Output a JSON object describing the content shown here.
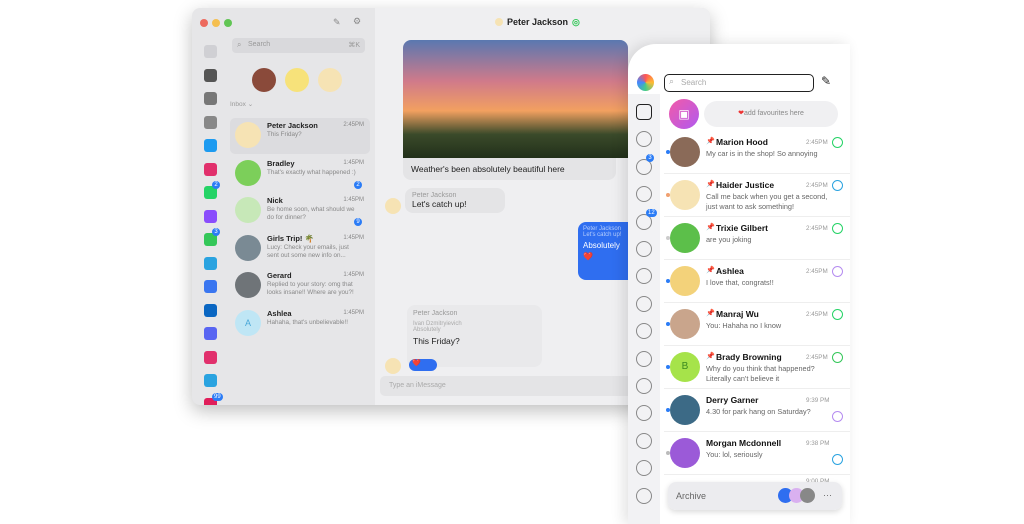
{
  "desktop": {
    "chat_title": "Peter Jackson",
    "search_placeholder": "Search",
    "search_shortcut": "⌘K",
    "inbox_label": "Inbox ⌄",
    "rail": [
      {
        "icon": "layers-icon",
        "color": "#d0d0d4"
      },
      {
        "icon": "chat-bubbles-icon",
        "color": "#555"
      },
      {
        "icon": "inbox-icon",
        "color": "#777"
      },
      {
        "icon": "arrow-icon",
        "color": "#888"
      },
      {
        "icon": "twitter-icon",
        "color": "#1d9bf0"
      },
      {
        "icon": "instagram-icon",
        "color": "#e1306c"
      },
      {
        "icon": "whatsapp-icon",
        "color": "#25d366",
        "badge": "2"
      },
      {
        "icon": "messenger-icon",
        "color": "#8a4dfc"
      },
      {
        "icon": "imessage-icon",
        "color": "#34c759",
        "badge": "3"
      },
      {
        "icon": "telegram-icon",
        "color": "#2aa3e0"
      },
      {
        "icon": "signal-icon",
        "color": "#3a76f0"
      },
      {
        "icon": "linkedin-icon",
        "color": "#0a66c2"
      },
      {
        "icon": "discord-icon",
        "color": "#5865f2"
      },
      {
        "icon": "instagram-icon",
        "color": "#e1306c"
      },
      {
        "icon": "telegram-icon",
        "color": "#2aa3e0"
      },
      {
        "icon": "slack-icon",
        "color": "#e01e5a",
        "badge": "99"
      }
    ],
    "conversations": [
      {
        "name": "Peter Jackson",
        "time": "2:45PM",
        "preview": "This Friday?",
        "avatar": "#f6e3b4",
        "pinned": true
      },
      {
        "name": "Bradley",
        "time": "1:45PM",
        "preview": "That's exactly what happened :)",
        "avatar": "#7ccf5a",
        "badge": "2"
      },
      {
        "name": "Nick",
        "time": "1:45PM",
        "preview": "Be home soon, what should we do for dinner?",
        "avatar": "#c7e8b8",
        "badge": "9"
      },
      {
        "name": "Girls Trip! 🌴",
        "time": "1:45PM",
        "preview": "Lucy: Check your emails, just sent out some new info on...",
        "avatar": "#7a8a94"
      },
      {
        "name": "Gerard",
        "time": "1:45PM",
        "preview": "Replied to your story: omg that looks insane!! Where are you?!",
        "avatar": "#6f7478"
      },
      {
        "name": "Ashlea",
        "time": "1:45PM",
        "preview": "Hahaha, that's unbelievable!!",
        "avatar": "#bfe6f5",
        "initial": "A"
      }
    ],
    "messages": {
      "m1": "Weather's been absolutely beautiful here",
      "m2_sender": "Peter Jackson",
      "m2": "Let's catch up!",
      "out_quote_name": "Peter Jackson",
      "out_quote": "Let's catch up!",
      "out_text": "Absolutely",
      "m3_sender": "Peter Jackson",
      "m3_quote_name": "Ivan Dzmitryievich",
      "m3_quote": "Absolutely",
      "m3": "This Friday?"
    },
    "composer_placeholder": "Type an iMessage"
  },
  "mobile": {
    "search_placeholder": "Search",
    "favourites_hint": "add favourites here",
    "rail": [
      {
        "icon": "chats-icon"
      },
      {
        "icon": "slack-icon"
      },
      {
        "icon": "dots-circle-icon",
        "badge": "3"
      },
      {
        "icon": "whatsapp-icon"
      },
      {
        "icon": "telegram-icon",
        "badge": "12"
      },
      {
        "icon": "discord-icon"
      },
      {
        "icon": "signal-icon"
      },
      {
        "icon": "twitter-icon"
      },
      {
        "icon": "beeper-icon"
      },
      {
        "icon": "messenger-icon"
      },
      {
        "icon": "google-chat-icon"
      },
      {
        "icon": "instagram-icon"
      },
      {
        "icon": "matrix-icon"
      },
      {
        "icon": "chat-icon"
      },
      {
        "icon": "menu-icon"
      }
    ],
    "conversations": [
      {
        "name": "Marion Hood",
        "time": "2:45PM",
        "preview": "My car is in the shop! So annoying",
        "avatar": "#8a6a58",
        "network": "#25d366",
        "dot": "#2b7cf6",
        "pinned": true
      },
      {
        "name": "Haider Justice",
        "time": "2:45PM",
        "preview": "Call me back when you get a second, just want to ask something!",
        "avatar": "#f6e3b4",
        "network": "#2aa3e0",
        "dot": "#f0a070",
        "pinned": true
      },
      {
        "name": "Trixie Gilbert",
        "time": "2:45PM",
        "preview": "are you joking",
        "avatar": "#5cbf4a",
        "network": "#25d366",
        "dot": "#ccc",
        "pinned": true
      },
      {
        "name": "Ashlea",
        "time": "2:45PM",
        "preview": "I love that, congrats!!",
        "avatar": "#f3d27a",
        "network": "#b58cf0",
        "dot": "#2b7cf6",
        "pinned": true
      },
      {
        "name": "Manraj Wu",
        "time": "2:45PM",
        "preview": "You: Hahaha no I know",
        "avatar": "#c9a58c",
        "network": "#25d366",
        "dot": "#2b7cf6",
        "pinned": true
      },
      {
        "name": "Brady Browning",
        "time": "2:45PM",
        "preview": "Why do you think that happened? Literally can't believe it",
        "avatar": "#a6e34a",
        "initial": "B",
        "network": "#34c759",
        "dot": "#2b7cf6",
        "pinned": true
      },
      {
        "name": "Derry Garner",
        "time": "9:39 PM",
        "preview": "4.30 for park hang on Saturday?",
        "avatar": "#3c6a86",
        "network": "#b58cf0",
        "dot": "#2b7cf6"
      },
      {
        "name": "Morgan Mcdonnell",
        "time": "9:38 PM",
        "preview": "You: lol, seriously",
        "avatar": "#9b5ad8",
        "network": "#2aa3e0",
        "dot": "#bbb"
      }
    ],
    "partial_time": "9:00 PM",
    "archive_label": "Archive",
    "more_label": "···"
  }
}
